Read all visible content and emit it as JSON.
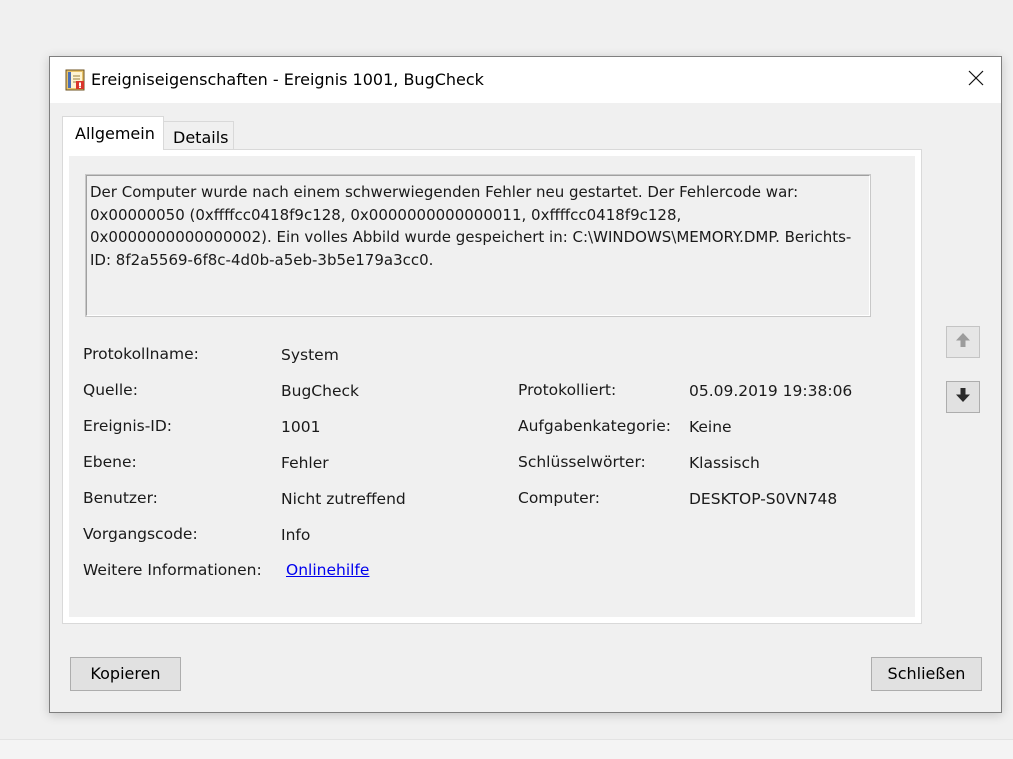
{
  "window": {
    "title": "Ereigniseigenschaften - Ereignis 1001, BugCheck",
    "icon": "event-properties-icon",
    "close_icon": "close-icon"
  },
  "tabs": [
    {
      "label": "Allgemein",
      "active": true
    },
    {
      "label": "Details",
      "active": false
    }
  ],
  "description": "Der Computer wurde nach einem schwerwiegenden Fehler neu gestartet. Der Fehlercode war: 0x00000050 (0xffffcc0418f9c128, 0x0000000000000011, 0xffffcc0418f9c128, 0x0000000000000002). Ein volles Abbild wurde gespeichert in: C:\\WINDOWS\\MEMORY.DMP. Berichts-ID: 8f2a5569-6f8c-4d0b-a5eb-3b5e179a3cc0.",
  "fields": {
    "log_name": {
      "label": "Protokollname:",
      "value": "System"
    },
    "source": {
      "label": "Quelle:",
      "value": "BugCheck"
    },
    "logged": {
      "label": "Protokolliert:",
      "value": "05.09.2019 19:38:06"
    },
    "event_id": {
      "label": "Ereignis-ID:",
      "value": "1001"
    },
    "task_category": {
      "label": "Aufgabenkategorie:",
      "value": "Keine"
    },
    "level": {
      "label": "Ebene:",
      "value": "Fehler"
    },
    "keywords": {
      "label": "Schlüsselwörter:",
      "value": "Klassisch"
    },
    "user": {
      "label": "Benutzer:",
      "value": "Nicht zutreffend"
    },
    "computer": {
      "label": "Computer:",
      "value": "DESKTOP-S0VN748"
    },
    "opcode": {
      "label": "Vorgangscode:",
      "value": "Info"
    },
    "more_info": {
      "label": "Weitere Informationen:",
      "link": "Onlinehilfe"
    }
  },
  "nav": {
    "up_icon": "arrow-up-icon",
    "down_icon": "arrow-down-icon"
  },
  "buttons": {
    "copy": "Kopieren",
    "close": "Schließen"
  }
}
